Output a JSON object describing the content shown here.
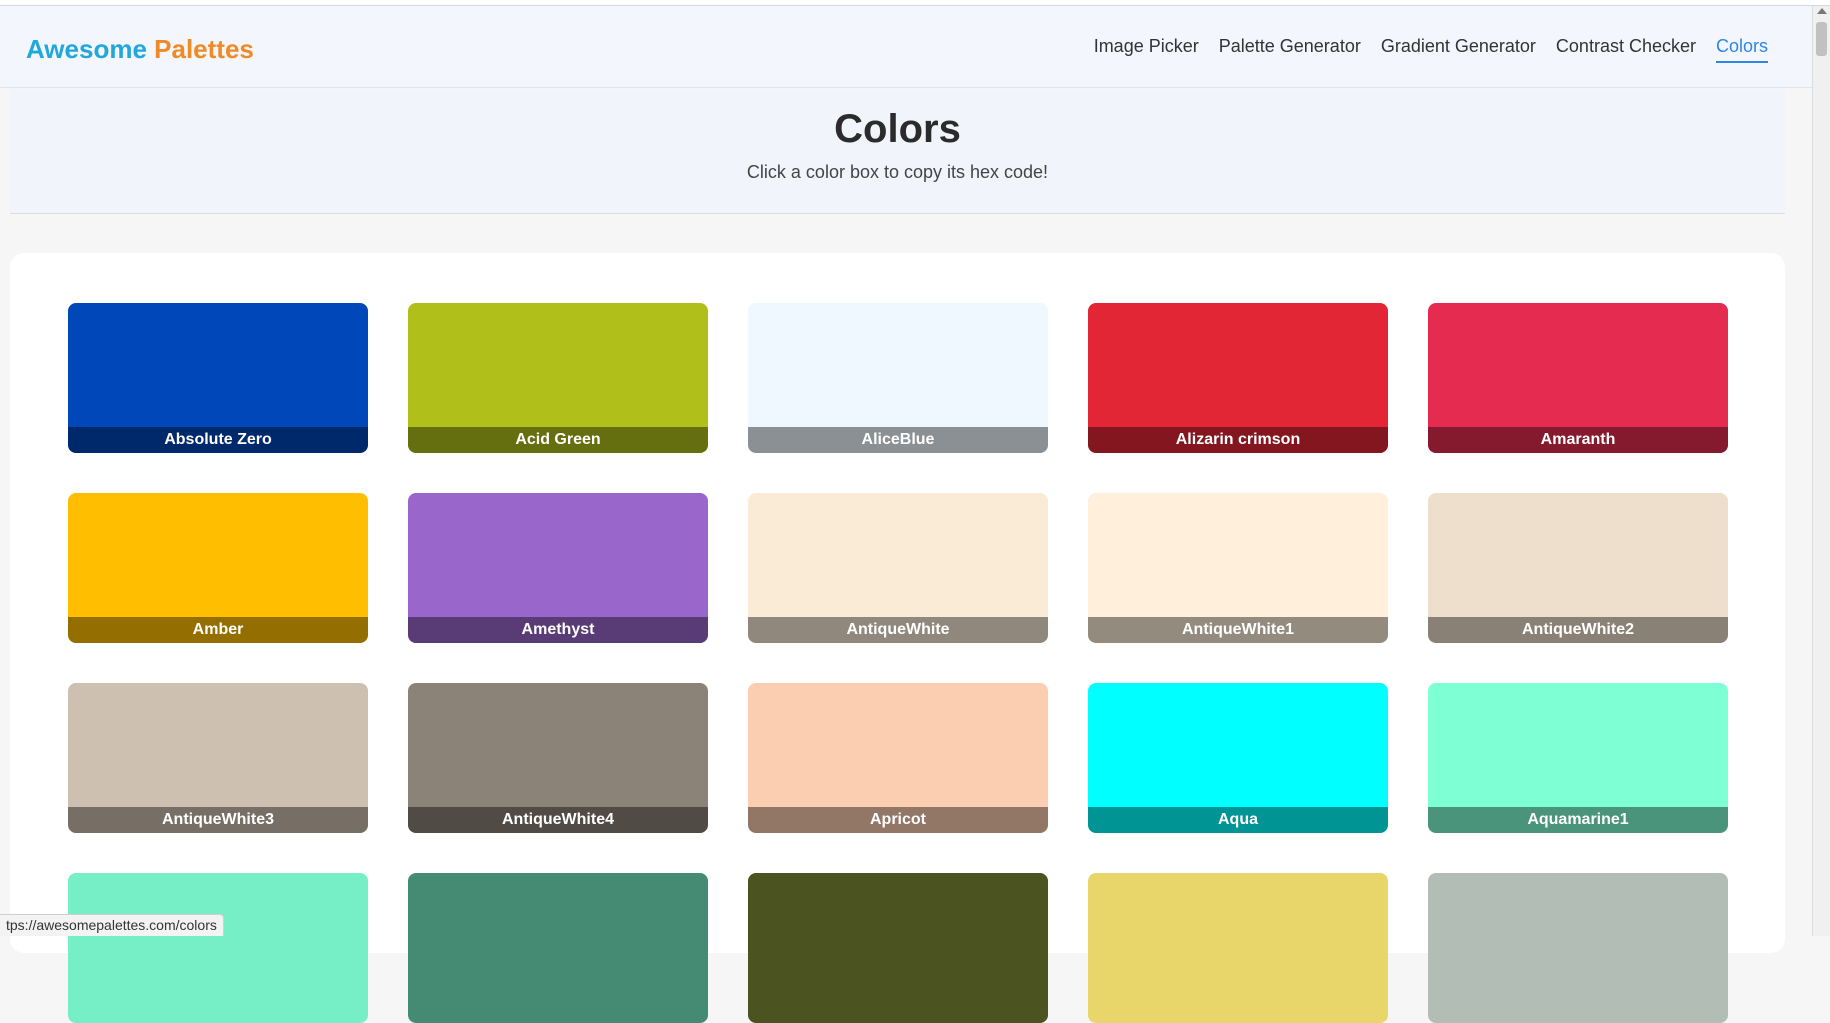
{
  "logo": {
    "part1": "Awesome",
    "part2": "Palettes"
  },
  "nav": [
    {
      "label": "Image Picker",
      "active": false
    },
    {
      "label": "Palette Generator",
      "active": false
    },
    {
      "label": "Gradient Generator",
      "active": false
    },
    {
      "label": "Contrast Checker",
      "active": false
    },
    {
      "label": "Colors",
      "active": true
    }
  ],
  "hero": {
    "title": "Colors",
    "subtitle": "Click a color box to copy its hex code!"
  },
  "colors": [
    {
      "name": "Absolute Zero",
      "hex": "#0048BA"
    },
    {
      "name": "Acid Green",
      "hex": "#B0BF1A"
    },
    {
      "name": "AliceBlue",
      "hex": "#F0F8FF"
    },
    {
      "name": "Alizarin crimson",
      "hex": "#E32636"
    },
    {
      "name": "Amaranth",
      "hex": "#E52B50"
    },
    {
      "name": "Amber",
      "hex": "#FFBF00"
    },
    {
      "name": "Amethyst",
      "hex": "#9966CC"
    },
    {
      "name": "AntiqueWhite",
      "hex": "#FAEBD7"
    },
    {
      "name": "AntiqueWhite1",
      "hex": "#FFEFDB"
    },
    {
      "name": "AntiqueWhite2",
      "hex": "#EEDFCC"
    },
    {
      "name": "AntiqueWhite3",
      "hex": "#CDC0B0"
    },
    {
      "name": "AntiqueWhite4",
      "hex": "#8B8378"
    },
    {
      "name": "Apricot",
      "hex": "#FBCEB1"
    },
    {
      "name": "Aqua",
      "hex": "#00FFFF"
    },
    {
      "name": "Aquamarine1",
      "hex": "#7FFFD4"
    },
    {
      "name": "",
      "hex": "#76EEC6"
    },
    {
      "name": "",
      "hex": "#458B74"
    },
    {
      "name": "",
      "hex": "#4B5320"
    },
    {
      "name": "",
      "hex": "#E9D66B"
    },
    {
      "name": "",
      "hex": "#B2BEB5"
    }
  ],
  "status": {
    "url": "tps://awesomepalettes.com/colors"
  }
}
